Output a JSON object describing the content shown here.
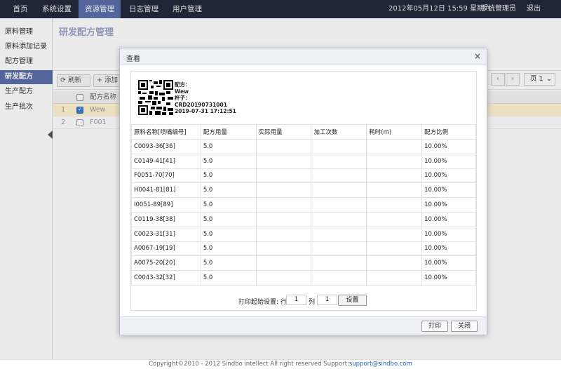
{
  "topnav": {
    "items": [
      "首页",
      "系统设置",
      "资源管理",
      "日志管理",
      "用户管理"
    ],
    "datetime": "2012年05月12日 15:59 星期六",
    "user": "系统管理员",
    "logout": "退出"
  },
  "sidebar": {
    "items": [
      "原料管理",
      "原料添加记录",
      "配方管理",
      "研发配方",
      "生产配方",
      "生产批次"
    ],
    "active_index": 3
  },
  "main": {
    "title": "研发配方管理",
    "toolbar": {
      "refresh": "刷新",
      "add": "添加"
    },
    "pager": {
      "page": "页 1"
    },
    "grid": {
      "header": "配方名称",
      "rows": [
        {
          "num": "1",
          "name": "Wew",
          "checked": true
        },
        {
          "num": "2",
          "name": "F001",
          "checked": false
        }
      ]
    }
  },
  "modal": {
    "title": "查看",
    "close": "×",
    "info": {
      "line1": "配方：",
      "line2": "Wew",
      "line3": "杯子：",
      "line4": "CRD20190731001",
      "line5": "2019-07-31 17:12:51"
    },
    "table": {
      "columns": [
        "原料名称[喷嘴编号]",
        "配方用量",
        "实际用量",
        "加工次数",
        "耗时(m)",
        "配方比例"
      ],
      "rows": [
        [
          "C0093-36[36]",
          "5.0",
          "",
          "",
          "",
          "10.00%"
        ],
        [
          "C0149-41[41]",
          "5.0",
          "",
          "",
          "",
          "10.00%"
        ],
        [
          "F0051-70[70]",
          "5.0",
          "",
          "",
          "",
          "10.00%"
        ],
        [
          "H0041-81[81]",
          "5.0",
          "",
          "",
          "",
          "10.00%"
        ],
        [
          "I0051-89[89]",
          "5.0",
          "",
          "",
          "",
          "10.00%"
        ],
        [
          "C0119-38[38]",
          "5.0",
          "",
          "",
          "",
          "10.00%"
        ],
        [
          "C0023-31[31]",
          "5.0",
          "",
          "",
          "",
          "10.00%"
        ],
        [
          "A0067-19[19]",
          "5.0",
          "",
          "",
          "",
          "10.00%"
        ],
        [
          "A0075-20[20]",
          "5.0",
          "",
          "",
          "",
          "10.00%"
        ],
        [
          "C0043-32[32]",
          "5.0",
          "",
          "",
          "",
          "10.00%"
        ]
      ]
    },
    "print": {
      "label": "打印起始设置: 行",
      "row_value": "1",
      "col_label": "列",
      "col_value": "1",
      "set_button": "设置"
    },
    "footer": {
      "print": "打印",
      "close": "关闭"
    }
  },
  "footer": {
    "copyright": "Copyright©2010 - 2012 Sindbo intellect All right reserved Support:",
    "email": "support@sindbo.com"
  }
}
